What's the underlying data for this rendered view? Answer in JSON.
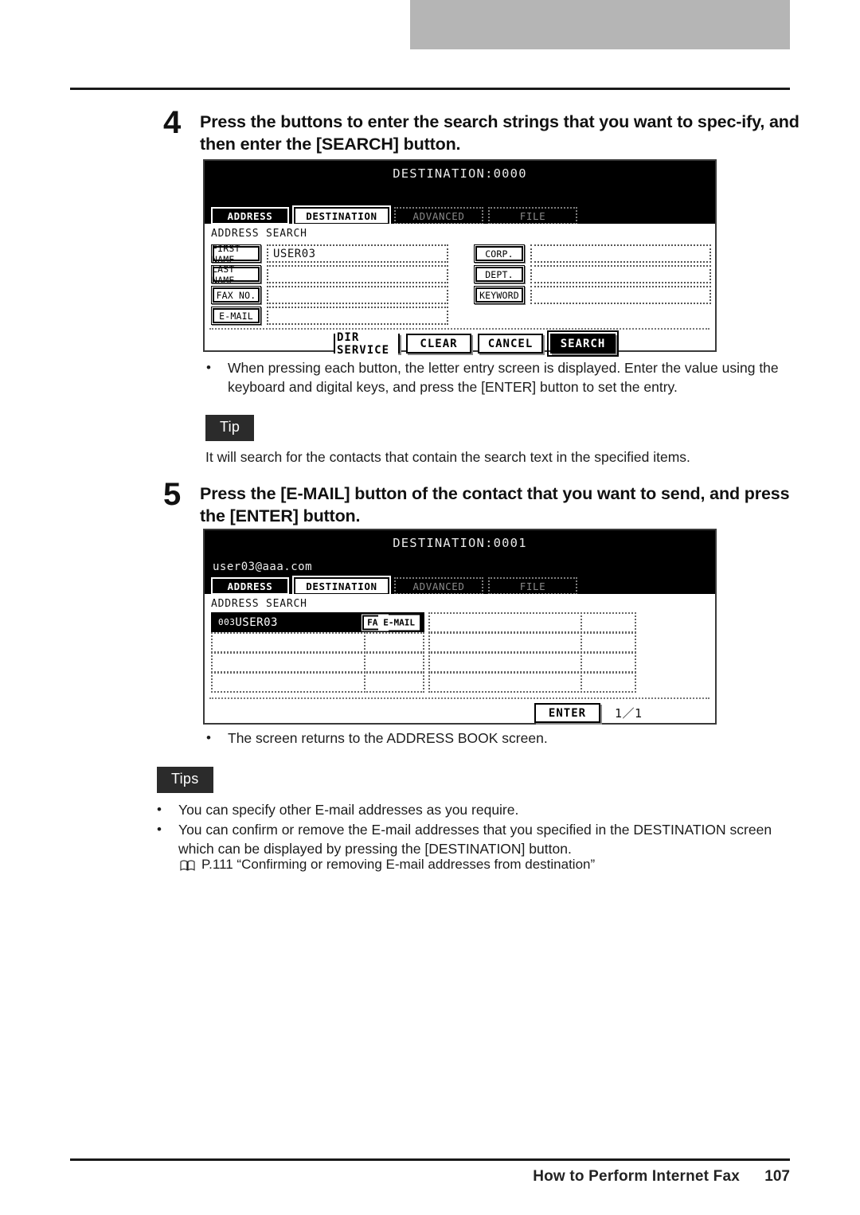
{
  "page": {
    "footer_title": "How to Perform Internet Fax",
    "footer_page": "107"
  },
  "step4": {
    "number": "4",
    "heading": "Press the buttons to enter the search strings that you want to spec-ify, and then enter the [SEARCH] button.",
    "note_bullet": "When pressing each button, the letter entry screen is displayed.  Enter the value using the keyboard and digital keys, and press the [ENTER] button to set the entry.",
    "note_bullet_dot": "•"
  },
  "tip_block": {
    "badge": "Tip",
    "text": "It will search for the contacts that contain the search text in the specified items."
  },
  "step5": {
    "number": "5",
    "heading": "Press the [E-MAIL] button of the contact that you want to send, and press the [ENTER] button.",
    "note_bullet": "The screen returns to the ADDRESS BOOK screen.",
    "note_bullet_dot": "•"
  },
  "tips_block": {
    "badge": "Tips",
    "bullet_dot": "•",
    "items": [
      "You can specify other E-mail addresses as you require.",
      "You can confirm or remove the E-mail addresses that you specified in the DESTINATION screen which can be displayed by pressing the [DESTINATION] button."
    ],
    "reference": "P.111 “Confirming or removing E-mail addresses from destination”",
    "reference_icon": "book-icon"
  },
  "screen1": {
    "title": "DESTINATION:0000",
    "tabs": [
      {
        "label": "ADDRESS",
        "state": "selected"
      },
      {
        "label": "DESTINATION",
        "state": "active"
      },
      {
        "label": "ADVANCED",
        "state": "disabled"
      },
      {
        "label": "FILE",
        "state": "disabled"
      }
    ],
    "section_label": "ADDRESS SEARCH",
    "left_fields": [
      {
        "button": "FIRST NAME",
        "value": "USER03"
      },
      {
        "button": "LAST NAME",
        "value": ""
      },
      {
        "button": "FAX NO.",
        "value": ""
      },
      {
        "button": "E-MAIL",
        "value": ""
      }
    ],
    "right_fields": [
      {
        "button": "CORP.",
        "value": ""
      },
      {
        "button": "DEPT.",
        "value": ""
      },
      {
        "button": "KEYWORD",
        "value": ""
      }
    ],
    "actions": [
      {
        "label": "DIR SERVICE",
        "style": "hatch"
      },
      {
        "label": "CLEAR",
        "style": "plain"
      },
      {
        "label": "CANCEL",
        "style": "plain"
      },
      {
        "label": "SEARCH",
        "style": "dark"
      }
    ]
  },
  "screen2": {
    "title": "DESTINATION:0001",
    "address_line": "user03@aaa.com",
    "tabs": [
      {
        "label": "ADDRESS",
        "state": "selected"
      },
      {
        "label": "DESTINATION",
        "state": "active"
      },
      {
        "label": "ADVANCED",
        "state": "disabled"
      },
      {
        "label": "FILE",
        "state": "disabled"
      }
    ],
    "section_label": "ADDRESS SEARCH",
    "result_index": "003",
    "result_name": "USER03",
    "result_fax_button": "FAX",
    "result_email_button": "E-MAIL",
    "enter_button": "ENTER",
    "page_indicator": "1／1"
  }
}
